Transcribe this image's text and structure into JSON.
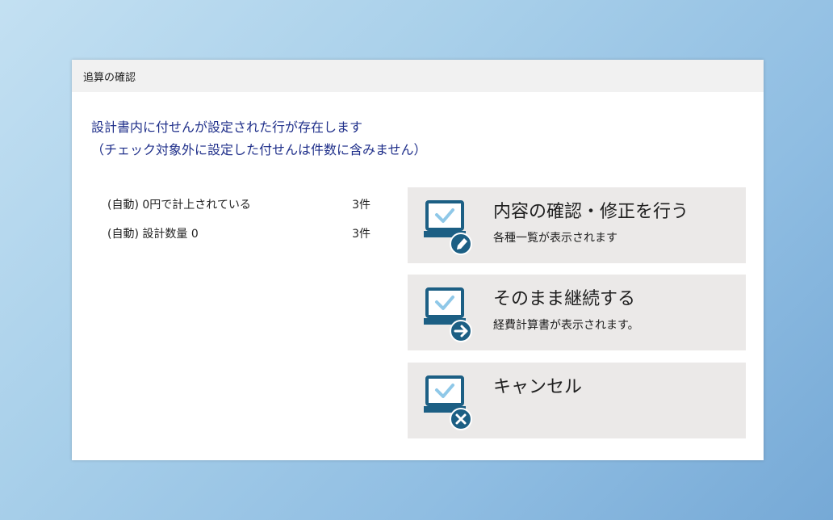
{
  "dialog": {
    "title": "追算の確認",
    "message_line1": "設計書内に付せんが設定された行が存在します",
    "message_line2": "（チェック対象外に設定した付せんは件数に含みません）"
  },
  "items": [
    {
      "label": "(自動) 0円で計上されている",
      "count": "3件"
    },
    {
      "label": "(自動) 設計数量 0",
      "count": "3件"
    }
  ],
  "actions": {
    "edit": {
      "title": "内容の確認・修正を行う",
      "subtitle": "各種一覧が表示されます",
      "icon": "laptop-pencil-icon"
    },
    "continue": {
      "title": "そのまま継続する",
      "subtitle": "経費計算書が表示されます。",
      "icon": "laptop-arrow-icon"
    },
    "cancel": {
      "title": "キャンセル",
      "subtitle": "",
      "icon": "laptop-close-icon"
    }
  },
  "colors": {
    "message_text": "#1f2f8a",
    "icon_dark": "#1c5f84",
    "icon_check": "#8fc8e8",
    "button_bg": "#ebe9e8",
    "titlebar_bg": "#f1f1f1"
  }
}
